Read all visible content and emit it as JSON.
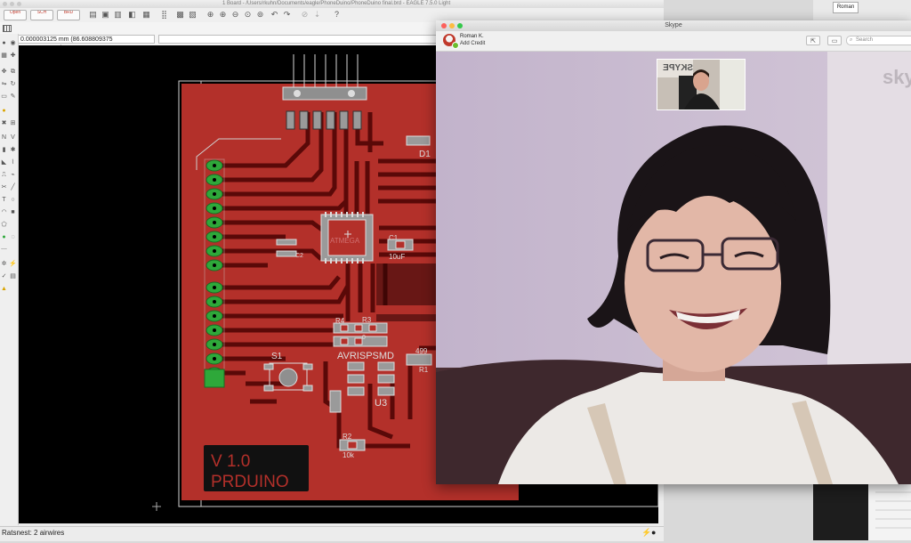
{
  "eagle": {
    "window_title": "1 Board - /Users/rkuhn/Documents/eagle/PhoneDuino/PhoneDuino final.brd - EAGLE 7.5.0 Light",
    "toolbar": {
      "open_label": "Open",
      "sch_label": "SCH",
      "brd_label": "BRD",
      "icons": [
        "save-icon",
        "print-icon",
        "cam-icon",
        "zoom-fit-icon",
        "zoom-in-icon",
        "zoom-out-icon",
        "redraw-icon",
        "undo-icon",
        "redo-icon",
        "stop-icon",
        "go-icon",
        "help-icon"
      ]
    },
    "coord_readout": "0.000003125 mm (86.608809375 56.688231250)",
    "status_text": "Ratsnest: 2 airwires",
    "board": {
      "board_labels": [
        "V 1.0",
        "PRDUINO"
      ],
      "part_labels": {
        "d1": "D1",
        "c1": "C1",
        "c1_value": "10uF",
        "r3": "R3",
        "r4": "R4",
        "r0": "0",
        "s1": "S1",
        "avr": "AVRISPSMD",
        "r1": "R1",
        "r1_value": "499",
        "u3": "U3",
        "r2": "R2",
        "r2_value": "10k",
        "c2": "C2",
        "atmega": "ATMEGA"
      }
    }
  },
  "skype": {
    "window_title": "Skype",
    "contact_name": "Roman K.",
    "add_credit": "Add Credit",
    "search_placeholder": "Search",
    "self_view_banner": "SKYPE",
    "watermark": "sky"
  },
  "desktop": {
    "roman_label": "Roman"
  },
  "colors": {
    "board_red": "#b3302a",
    "copper": "#6b0f0e",
    "pad_green": "#2ea83a",
    "skype_wall": "#c8b9cf"
  }
}
